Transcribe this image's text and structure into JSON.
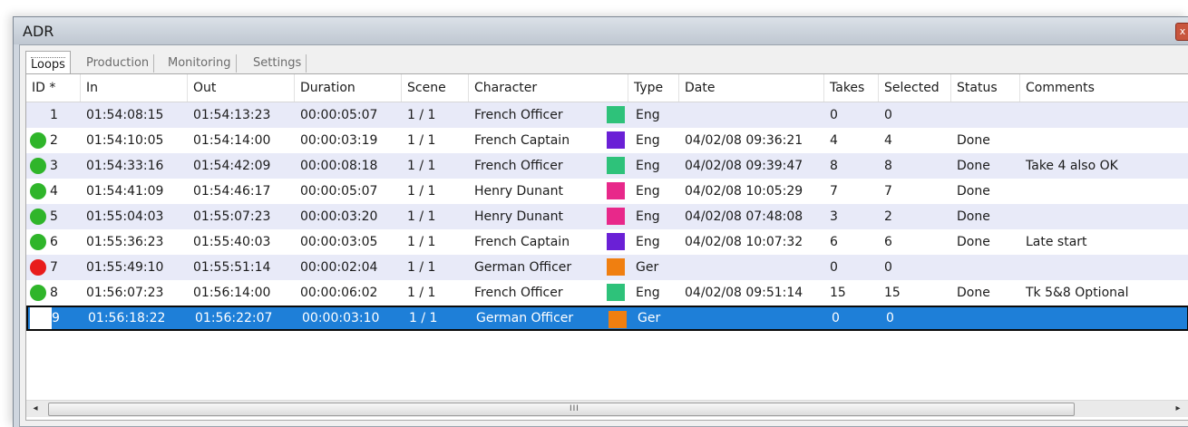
{
  "window": {
    "title": "ADR"
  },
  "tabs": [
    "Loops",
    "Production",
    "Monitoring",
    "Settings"
  ],
  "columns": [
    "ID *",
    "In",
    "Out",
    "Duration",
    "Scene",
    "Character",
    "Type",
    "Date",
    "Takes",
    "Selected",
    "Status",
    "Comments"
  ],
  "rows": [
    {
      "id": "1",
      "status_dot": "none",
      "in": "01:54:08:15",
      "out": "01:54:13:23",
      "duration": "00:00:05:07",
      "scene": "1 / 1",
      "character": "French Officer",
      "char_color": "#2ec27a",
      "type": "Eng",
      "date": "",
      "takes": "0",
      "selected": "0",
      "status": "",
      "comments": ""
    },
    {
      "id": "2",
      "status_dot": "green",
      "in": "01:54:10:05",
      "out": "01:54:14:00",
      "duration": "00:00:03:19",
      "scene": "1 / 1",
      "character": "French Captain",
      "char_color": "#6a20d6",
      "type": "Eng",
      "date": "04/02/08 09:36:21",
      "takes": "4",
      "selected": "4",
      "status": "Done",
      "comments": ""
    },
    {
      "id": "3",
      "status_dot": "green",
      "in": "01:54:33:16",
      "out": "01:54:42:09",
      "duration": "00:00:08:18",
      "scene": "1 / 1",
      "character": "French Officer",
      "char_color": "#2ec27a",
      "type": "Eng",
      "date": "04/02/08 09:39:47",
      "takes": "8",
      "selected": "8",
      "status": "Done",
      "comments": "Take 4 also OK"
    },
    {
      "id": "4",
      "status_dot": "green",
      "in": "01:54:41:09",
      "out": "01:54:46:17",
      "duration": "00:00:05:07",
      "scene": "1 / 1",
      "character": "Henry Dunant",
      "char_color": "#e8288a",
      "type": "Eng",
      "date": "04/02/08 10:05:29",
      "takes": "7",
      "selected": "7",
      "status": "Done",
      "comments": ""
    },
    {
      "id": "5",
      "status_dot": "green",
      "in": "01:55:04:03",
      "out": "01:55:07:23",
      "duration": "00:00:03:20",
      "scene": "1 / 1",
      "character": "Henry Dunant",
      "char_color": "#e8288a",
      "type": "Eng",
      "date": "04/02/08 07:48:08",
      "takes": "3",
      "selected": "2",
      "status": "Done",
      "comments": ""
    },
    {
      "id": "6",
      "status_dot": "green",
      "in": "01:55:36:23",
      "out": "01:55:40:03",
      "duration": "00:00:03:05",
      "scene": "1 / 1",
      "character": "French Captain",
      "char_color": "#6a20d6",
      "type": "Eng",
      "date": "04/02/08 10:07:32",
      "takes": "6",
      "selected": "6",
      "status": "Done",
      "comments": "Late start"
    },
    {
      "id": "7",
      "status_dot": "red",
      "in": "01:55:49:10",
      "out": "01:55:51:14",
      "duration": "00:00:02:04",
      "scene": "1 / 1",
      "character": "German Officer",
      "char_color": "#f07f10",
      "type": "Ger",
      "date": "",
      "takes": "0",
      "selected": "0",
      "status": "",
      "comments": ""
    },
    {
      "id": "8",
      "status_dot": "green",
      "in": "01:56:07:23",
      "out": "01:56:14:00",
      "duration": "00:00:06:02",
      "scene": "1 / 1",
      "character": "French Officer",
      "char_color": "#2ec27a",
      "type": "Eng",
      "date": "04/02/08 09:51:14",
      "takes": "15",
      "selected": "15",
      "status": "Done",
      "comments": "Tk 5&8 Optional"
    },
    {
      "id": "9",
      "status_dot": "none",
      "in": "01:56:18:22",
      "out": "01:56:22:07",
      "duration": "00:00:03:10",
      "scene": "1 / 1",
      "character": "German Officer",
      "char_color": "#f07f10",
      "type": "Ger",
      "date": "",
      "takes": "0",
      "selected": "0",
      "status": "",
      "comments": "",
      "selected_row": true
    }
  ],
  "scrollbar": {
    "grip": "III",
    "left_arrow": "◂",
    "right_arrow": "▸"
  },
  "icons": {
    "close": "x"
  }
}
